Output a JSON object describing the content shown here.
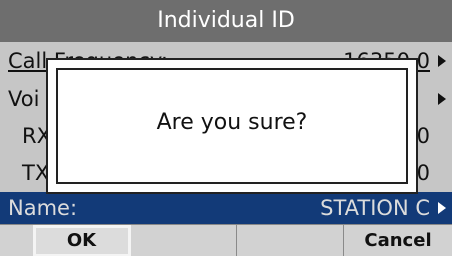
{
  "header": {
    "title": "Individual ID"
  },
  "rows": [
    {
      "label": "Call Frequency:",
      "value": "16350.0",
      "has_arrow": true
    },
    {
      "label": "Voi",
      "value": "",
      "has_arrow": true
    },
    {
      "label": "RX",
      "value": "0",
      "has_arrow": false
    },
    {
      "label": "TX",
      "value": "0",
      "has_arrow": false
    },
    {
      "label": "Name:",
      "value": "STATION C",
      "has_arrow": true,
      "selected": true
    }
  ],
  "dialog": {
    "message": "Are you sure?"
  },
  "softkeys": [
    {
      "label": "OK",
      "focused": true
    },
    {
      "label": ""
    },
    {
      "label": ""
    },
    {
      "label": "Cancel"
    }
  ],
  "colors": {
    "title_bar": "#6e6e6e",
    "selected_row": "#123a78",
    "background": "#c6c6c6"
  }
}
